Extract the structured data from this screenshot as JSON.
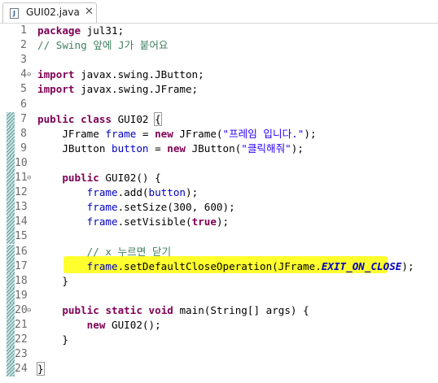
{
  "tab": {
    "title": "GUI02.java",
    "file_icon": "J",
    "close_glyph": "✕"
  },
  "fold_glyph": "⊖",
  "lines": [
    {
      "num": "1",
      "tokens": [
        {
          "t": "package",
          "c": "kw"
        },
        {
          "t": " jul31;",
          "c": ""
        }
      ]
    },
    {
      "num": "2",
      "tokens": [
        {
          "t": "// Swing 앞에 J가 붙어요",
          "c": "cm"
        }
      ]
    },
    {
      "num": "3",
      "tokens": []
    },
    {
      "num": "4",
      "fold": true,
      "tokens": [
        {
          "t": "import",
          "c": "kw"
        },
        {
          "t": " javax.swing.JButton;",
          "c": ""
        }
      ]
    },
    {
      "num": "5",
      "tokens": [
        {
          "t": "import",
          "c": "kw"
        },
        {
          "t": " javax.swing.JFrame;",
          "c": ""
        }
      ]
    },
    {
      "num": "6",
      "tokens": []
    },
    {
      "num": "7",
      "ruler": true,
      "tokens": [
        {
          "t": "public",
          "c": "kw"
        },
        {
          "t": " ",
          "c": ""
        },
        {
          "t": "class",
          "c": "kw"
        },
        {
          "t": " GUI02 ",
          "c": ""
        },
        {
          "t": "{",
          "c": "bracket"
        }
      ]
    },
    {
      "num": "8",
      "ruler": true,
      "tokens": [
        {
          "t": "    JFrame ",
          "c": ""
        },
        {
          "t": "frame",
          "c": "fld"
        },
        {
          "t": " = ",
          "c": ""
        },
        {
          "t": "new",
          "c": "kw"
        },
        {
          "t": " JFrame(",
          "c": ""
        },
        {
          "t": "\"프레임 입니다.\"",
          "c": "st"
        },
        {
          "t": ");",
          "c": ""
        }
      ]
    },
    {
      "num": "9",
      "ruler": true,
      "tokens": [
        {
          "t": "    JButton ",
          "c": ""
        },
        {
          "t": "button",
          "c": "fld"
        },
        {
          "t": " = ",
          "c": ""
        },
        {
          "t": "new",
          "c": "kw"
        },
        {
          "t": " JButton(",
          "c": ""
        },
        {
          "t": "\"클릭해줘\"",
          "c": "st"
        },
        {
          "t": ");",
          "c": ""
        }
      ]
    },
    {
      "num": "10",
      "ruler": true,
      "tokens": []
    },
    {
      "num": "11",
      "ruler": true,
      "fold": true,
      "tokens": [
        {
          "t": "    ",
          "c": ""
        },
        {
          "t": "public",
          "c": "kw"
        },
        {
          "t": " GUI02() {",
          "c": ""
        }
      ]
    },
    {
      "num": "12",
      "ruler": true,
      "tokens": [
        {
          "t": "        ",
          "c": ""
        },
        {
          "t": "frame",
          "c": "fld"
        },
        {
          "t": ".add(",
          "c": ""
        },
        {
          "t": "button",
          "c": "fld"
        },
        {
          "t": ");",
          "c": ""
        }
      ]
    },
    {
      "num": "13",
      "ruler": true,
      "tokens": [
        {
          "t": "        ",
          "c": ""
        },
        {
          "t": "frame",
          "c": "fld"
        },
        {
          "t": ".setSize(300, 600);",
          "c": ""
        }
      ]
    },
    {
      "num": "14",
      "ruler": true,
      "tokens": [
        {
          "t": "        ",
          "c": ""
        },
        {
          "t": "frame",
          "c": "fld"
        },
        {
          "t": ".setVisible(",
          "c": ""
        },
        {
          "t": "true",
          "c": "kw"
        },
        {
          "t": ");",
          "c": ""
        }
      ]
    },
    {
      "num": "15",
      "ruler": true,
      "tokens": []
    },
    {
      "num": "16",
      "ruler": true,
      "tokens": [
        {
          "t": "        ",
          "c": ""
        },
        {
          "t": "// x 누르면 닫기",
          "c": "cm"
        }
      ]
    },
    {
      "num": "17",
      "ruler": true,
      "tokens": [
        {
          "t": "        ",
          "c": ""
        },
        {
          "t": "frame",
          "c": "fld"
        },
        {
          "t": ".setDefaultCloseOperation(JFrame.",
          "c": ""
        },
        {
          "t": "EXIT_ON_CLOSE",
          "c": "cst"
        },
        {
          "t": ");",
          "c": ""
        }
      ]
    },
    {
      "num": "18",
      "ruler": true,
      "tokens": [
        {
          "t": "    }",
          "c": ""
        }
      ]
    },
    {
      "num": "19",
      "ruler": true,
      "tokens": []
    },
    {
      "num": "20",
      "ruler": true,
      "fold": true,
      "tokens": [
        {
          "t": "    ",
          "c": ""
        },
        {
          "t": "public",
          "c": "kw"
        },
        {
          "t": " ",
          "c": ""
        },
        {
          "t": "static",
          "c": "kw"
        },
        {
          "t": " ",
          "c": ""
        },
        {
          "t": "void",
          "c": "kw"
        },
        {
          "t": " main(String[] args) {",
          "c": ""
        }
      ]
    },
    {
      "num": "21",
      "ruler": true,
      "tokens": [
        {
          "t": "        ",
          "c": ""
        },
        {
          "t": "new",
          "c": "kw"
        },
        {
          "t": " GUI02();",
          "c": ""
        }
      ]
    },
    {
      "num": "22",
      "ruler": true,
      "tokens": [
        {
          "t": "    }",
          "c": ""
        }
      ]
    },
    {
      "num": "23",
      "ruler": true,
      "tokens": []
    },
    {
      "num": "24",
      "ruler": true,
      "tokens": [
        {
          "t": "}",
          "c": "bracket"
        }
      ]
    }
  ]
}
